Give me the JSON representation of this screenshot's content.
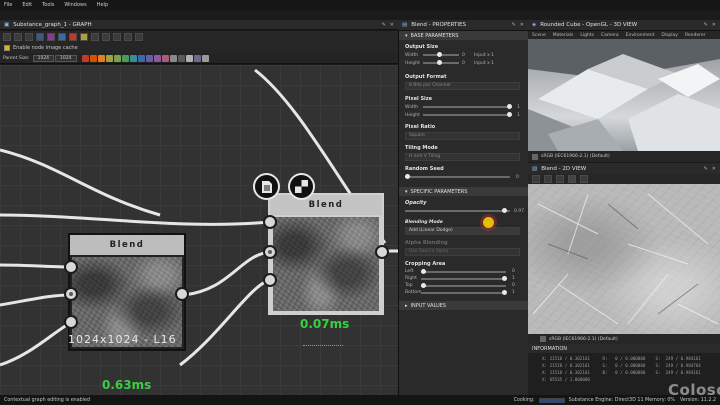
{
  "menubar": {
    "items": [
      "File",
      "Edit",
      "Tools",
      "Windows",
      "Help"
    ]
  },
  "graph": {
    "title": "Substance_graph_1 - GRAPH",
    "enable_cache_label": "Enable node image cache",
    "parent_size_label": "Parent Size:",
    "parent_size_value": "1024",
    "size_value": "1024",
    "toolbar_colors": [
      "#c0392b",
      "#d35400",
      "#e67e22",
      "#a0a040",
      "#7aa050",
      "#4a9a5a",
      "#3a8a9a",
      "#3a6aaa",
      "#6a5aaa",
      "#8a5a9a",
      "#aa5a7a",
      "#8a8a8a",
      "#5a5a5a",
      "#b0b0b0",
      "#6a6a8a",
      "#9a9a9a"
    ]
  },
  "nodes": {
    "left": {
      "title": "Blend",
      "resolution_label": "1024x1024 - L16",
      "timing": "0.63ms"
    },
    "right": {
      "title": "Blend",
      "timing": "0.07ms"
    }
  },
  "properties": {
    "title": "Blend - PROPERTIES",
    "base_section": "BASE PARAMETERS",
    "output_size": {
      "label": "Output Size",
      "width_label": "Width",
      "height_label": "Height",
      "width_value": "0",
      "height_value": "0",
      "width_mode": "Input x 1",
      "height_mode": "Input x 1"
    },
    "output_format": {
      "label": "Output Format",
      "value": "8 Bits per Channel"
    },
    "pixel_size": {
      "label": "Pixel Size",
      "width_label": "Width",
      "height_label": "Height",
      "width_value": "1",
      "height_value": "1"
    },
    "pixel_ratio": {
      "label": "Pixel Ratio",
      "value": "Square"
    },
    "tiling_mode": {
      "label": "Tiling Mode",
      "value": "H and V Tiling"
    },
    "random_seed": {
      "label": "Random Seed",
      "value": "0"
    },
    "specific_section": "SPECIFIC PARAMETERS",
    "opacity": {
      "label": "Opacity",
      "value": "0.97",
      "level": 0.97
    },
    "blending_mode": {
      "label": "Blending Mode",
      "value": "Add (Linear Dodge)"
    },
    "alpha_blending": {
      "label": "Alpha Blending",
      "value": "Use Source Alpha"
    },
    "cropping_area": {
      "label": "Cropping Area",
      "left_label": "Left",
      "right_label": "Right",
      "top_label": "Top",
      "bottom_label": "Bottom",
      "left_value": "0",
      "right_value": "1",
      "top_value": "0",
      "bottom_value": "1"
    },
    "input_values_section": "INPUT VALUES"
  },
  "view3d": {
    "title": "Rounded Cube - OpenGL - 3D VIEW",
    "menu": [
      "Scene",
      "Materials",
      "Lights",
      "Camera",
      "Environment",
      "Display",
      "Renderer"
    ],
    "colorspace": "sRGB (IEC61966-2.1) (Default)"
  },
  "view2d": {
    "title": "Blend - 2D VIEW",
    "colorspace": "sRGB (IEC61966-2.1) (Default)"
  },
  "info": {
    "title": "INFORMATION",
    "lines": [
      "X: 21518 / 0.302161     R:   0 / 0.000000    S:  249 / 0.984161",
      "X: 21518 / 0.302161     G:   0 / 0.000000    S:  249 / 0.984764",
      "X: 21518 / 0.302161     B:   0 / 0.000000    S:  249 / 0.984161",
      "X: 65535 / 1.000000"
    ]
  },
  "status": {
    "left": "Contextual graph editing is enabled",
    "cooking_label": "Cooking:",
    "engine": "Substance Engine: Direct3D 11  Memory: 0%",
    "version": "Version: 11.2.2"
  },
  "watermark": "Coloso."
}
